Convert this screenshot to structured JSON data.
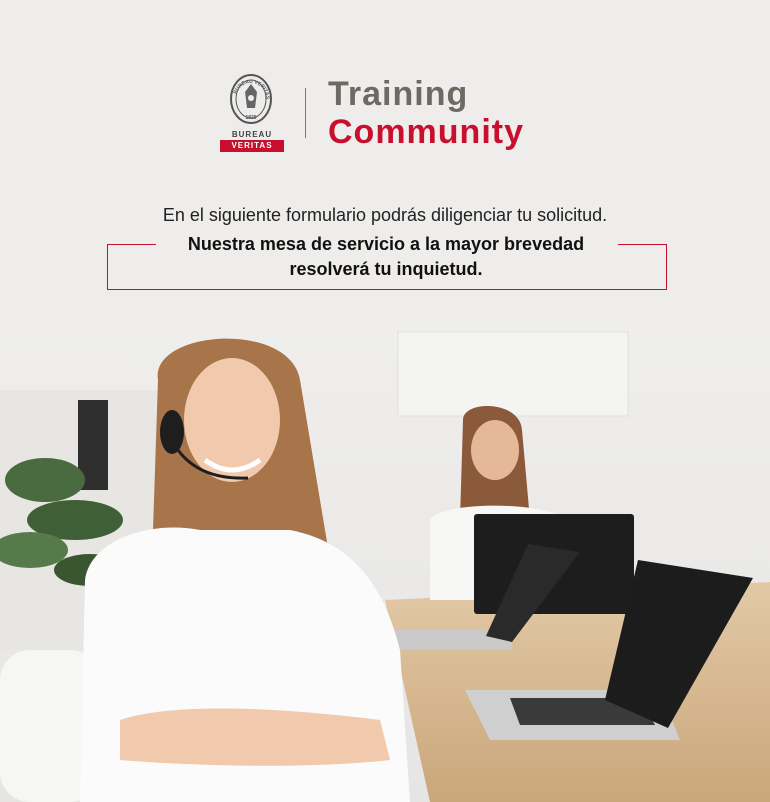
{
  "logo": {
    "seal_year": "1828",
    "seal_ring": "BUREAU VERITAS",
    "line1": "BUREAU",
    "line2": "VERITAS"
  },
  "brand": {
    "line1": "Training",
    "line2": "Community"
  },
  "intro": "En el siguiente formulario podrás diligenciar tu solicitud.",
  "notice": {
    "line1": "Nuestra mesa de servicio a la mayor brevedad",
    "line2": "resolverá tu inquietud."
  },
  "colors": {
    "accent": "#c8102e",
    "brand_gray": "#6d6a63",
    "background": "#eeedeb"
  }
}
